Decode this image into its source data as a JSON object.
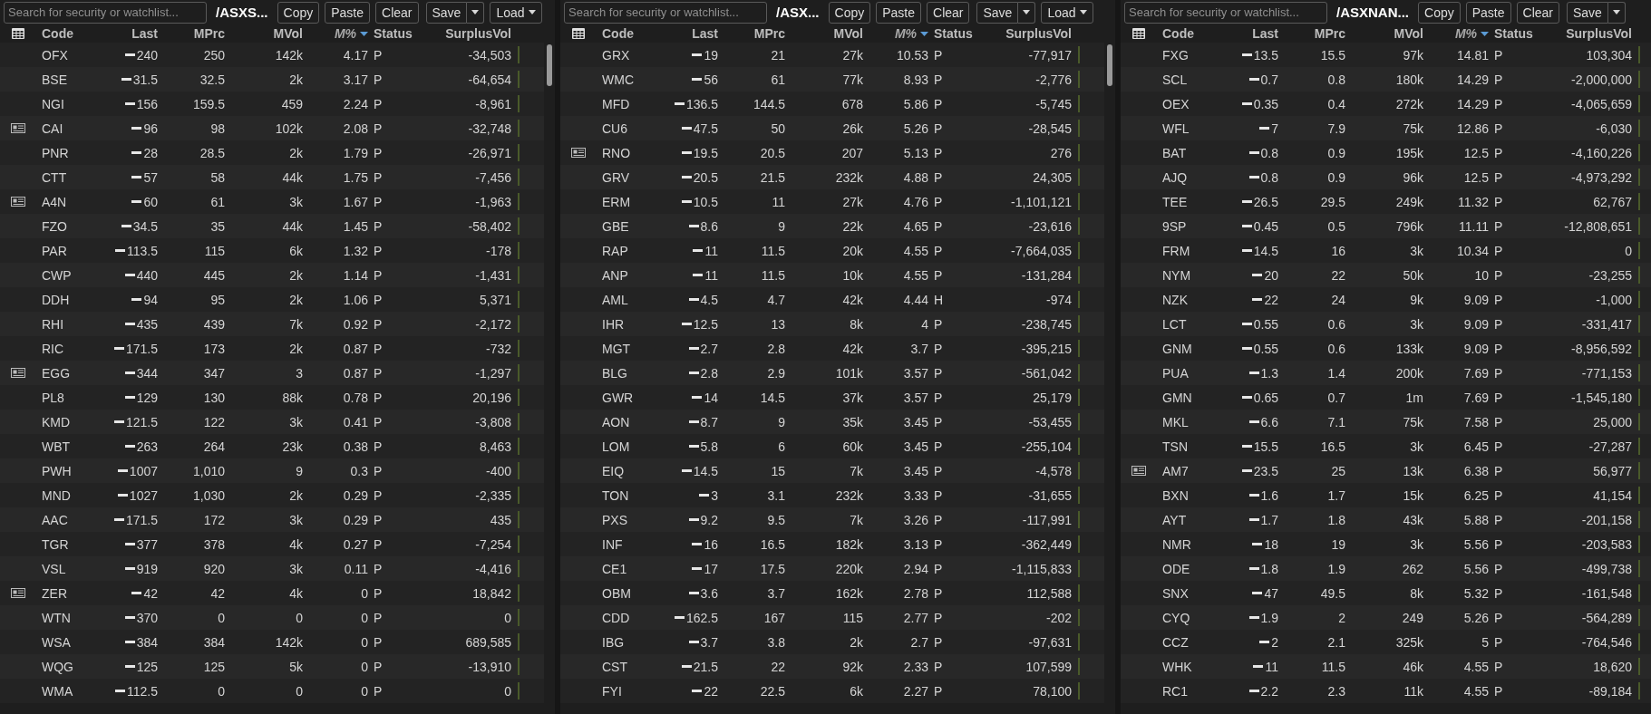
{
  "panels": [
    {
      "search": {
        "placeholder": "Search for security or watchlist..."
      },
      "title": "/ASXS...",
      "buttons": [
        {
          "label": "Copy",
          "kind": "plain"
        },
        {
          "label": "Paste",
          "kind": "plain"
        },
        {
          "label": "Clear",
          "kind": "plain"
        },
        {
          "label": "Save",
          "kind": "split"
        },
        {
          "label": "Load",
          "kind": "menu"
        }
      ],
      "columns": [
        {
          "label": "Code",
          "sorted": false
        },
        {
          "label": "Last",
          "sorted": false
        },
        {
          "label": "MPrc",
          "sorted": false
        },
        {
          "label": "MVol",
          "sorted": false
        },
        {
          "label": "M%",
          "sorted": true
        },
        {
          "label": "Status",
          "sorted": false
        },
        {
          "label": "SurplusVol",
          "sorted": false
        }
      ],
      "scrollbar": true,
      "rows": [
        {
          "news": false,
          "cells": [
            "OFX",
            "240",
            "250",
            "142k",
            "4.17",
            "P",
            "-34,503"
          ]
        },
        {
          "news": false,
          "cells": [
            "BSE",
            "31.5",
            "32.5",
            "2k",
            "3.17",
            "P",
            "-64,654"
          ]
        },
        {
          "news": false,
          "cells": [
            "NGI",
            "156",
            "159.5",
            "459",
            "2.24",
            "P",
            "-8,961"
          ]
        },
        {
          "news": true,
          "cells": [
            "CAI",
            "96",
            "98",
            "102k",
            "2.08",
            "P",
            "-32,748"
          ]
        },
        {
          "news": false,
          "cells": [
            "PNR",
            "28",
            "28.5",
            "2k",
            "1.79",
            "P",
            "-26,971"
          ]
        },
        {
          "news": false,
          "cells": [
            "CTT",
            "57",
            "58",
            "44k",
            "1.75",
            "P",
            "-7,456"
          ]
        },
        {
          "news": true,
          "cells": [
            "A4N",
            "60",
            "61",
            "3k",
            "1.67",
            "P",
            "-1,963"
          ]
        },
        {
          "news": false,
          "cells": [
            "FZO",
            "34.5",
            "35",
            "44k",
            "1.45",
            "P",
            "-58,402"
          ]
        },
        {
          "news": false,
          "cells": [
            "PAR",
            "113.5",
            "115",
            "6k",
            "1.32",
            "P",
            "-178"
          ]
        },
        {
          "news": false,
          "cells": [
            "CWP",
            "440",
            "445",
            "2k",
            "1.14",
            "P",
            "-1,431"
          ]
        },
        {
          "news": false,
          "cells": [
            "DDH",
            "94",
            "95",
            "2k",
            "1.06",
            "P",
            "5,371"
          ]
        },
        {
          "news": false,
          "cells": [
            "RHI",
            "435",
            "439",
            "7k",
            "0.92",
            "P",
            "-2,172"
          ]
        },
        {
          "news": false,
          "cells": [
            "RIC",
            "171.5",
            "173",
            "2k",
            "0.87",
            "P",
            "-732"
          ]
        },
        {
          "news": true,
          "cells": [
            "EGG",
            "344",
            "347",
            "3",
            "0.87",
            "P",
            "-1,297"
          ]
        },
        {
          "news": false,
          "cells": [
            "PL8",
            "129",
            "130",
            "88k",
            "0.78",
            "P",
            "20,196"
          ]
        },
        {
          "news": false,
          "cells": [
            "KMD",
            "121.5",
            "122",
            "3k",
            "0.41",
            "P",
            "-3,808"
          ]
        },
        {
          "news": false,
          "cells": [
            "WBT",
            "263",
            "264",
            "23k",
            "0.38",
            "P",
            "8,463"
          ]
        },
        {
          "news": false,
          "cells": [
            "PWH",
            "1007",
            "1,010",
            "9",
            "0.3",
            "P",
            "-400"
          ]
        },
        {
          "news": false,
          "cells": [
            "MND",
            "1027",
            "1,030",
            "2k",
            "0.29",
            "P",
            "-2,335"
          ]
        },
        {
          "news": false,
          "cells": [
            "AAC",
            "171.5",
            "172",
            "3k",
            "0.29",
            "P",
            "435"
          ]
        },
        {
          "news": false,
          "cells": [
            "TGR",
            "377",
            "378",
            "4k",
            "0.27",
            "P",
            "-7,254"
          ]
        },
        {
          "news": false,
          "cells": [
            "VSL",
            "919",
            "920",
            "3k",
            "0.11",
            "P",
            "-4,416"
          ]
        },
        {
          "news": true,
          "cells": [
            "ZER",
            "42",
            "42",
            "4k",
            "0",
            "P",
            "18,842"
          ]
        },
        {
          "news": false,
          "cells": [
            "WTN",
            "370",
            "0",
            "0",
            "0",
            "P",
            "0"
          ]
        },
        {
          "news": false,
          "cells": [
            "WSA",
            "384",
            "384",
            "142k",
            "0",
            "P",
            "689,585"
          ]
        },
        {
          "news": false,
          "cells": [
            "WQG",
            "125",
            "125",
            "5k",
            "0",
            "P",
            "-13,910"
          ]
        },
        {
          "news": false,
          "cells": [
            "WMA",
            "112.5",
            "0",
            "0",
            "0",
            "P",
            "0"
          ]
        }
      ]
    },
    {
      "search": {
        "placeholder": "Search for security or watchlist..."
      },
      "title": "/ASX...",
      "buttons": [
        {
          "label": "Copy",
          "kind": "plain"
        },
        {
          "label": "Paste",
          "kind": "plain"
        },
        {
          "label": "Clear",
          "kind": "plain"
        },
        {
          "label": "Save",
          "kind": "split"
        },
        {
          "label": "Load",
          "kind": "menu"
        }
      ],
      "columns": [
        {
          "label": "Code",
          "sorted": false
        },
        {
          "label": "Last",
          "sorted": false
        },
        {
          "label": "MPrc",
          "sorted": false
        },
        {
          "label": "MVol",
          "sorted": false
        },
        {
          "label": "M%",
          "sorted": true
        },
        {
          "label": "Status",
          "sorted": false
        },
        {
          "label": "SurplusVol",
          "sorted": false
        }
      ],
      "scrollbar": true,
      "rows": [
        {
          "news": false,
          "cells": [
            "GRX",
            "19",
            "21",
            "27k",
            "10.53",
            "P",
            "-77,917"
          ]
        },
        {
          "news": false,
          "cells": [
            "WMC",
            "56",
            "61",
            "77k",
            "8.93",
            "P",
            "-2,776"
          ]
        },
        {
          "news": false,
          "cells": [
            "MFD",
            "136.5",
            "144.5",
            "678",
            "5.86",
            "P",
            "-5,745"
          ]
        },
        {
          "news": false,
          "cells": [
            "CU6",
            "47.5",
            "50",
            "26k",
            "5.26",
            "P",
            "-28,545"
          ]
        },
        {
          "news": true,
          "cells": [
            "RNO",
            "19.5",
            "20.5",
            "207",
            "5.13",
            "P",
            "276"
          ]
        },
        {
          "news": false,
          "cells": [
            "GRV",
            "20.5",
            "21.5",
            "232k",
            "4.88",
            "P",
            "24,305"
          ]
        },
        {
          "news": false,
          "cells": [
            "ERM",
            "10.5",
            "11",
            "27k",
            "4.76",
            "P",
            "-1,101,121"
          ]
        },
        {
          "news": false,
          "cells": [
            "GBE",
            "8.6",
            "9",
            "22k",
            "4.65",
            "P",
            "-23,616"
          ]
        },
        {
          "news": false,
          "cells": [
            "RAP",
            "11",
            "11.5",
            "20k",
            "4.55",
            "P",
            "-7,664,035"
          ]
        },
        {
          "news": false,
          "cells": [
            "ANP",
            "11",
            "11.5",
            "10k",
            "4.55",
            "P",
            "-131,284"
          ]
        },
        {
          "news": false,
          "cells": [
            "AML",
            "4.5",
            "4.7",
            "42k",
            "4.44",
            "H",
            "-974"
          ]
        },
        {
          "news": false,
          "cells": [
            "IHR",
            "12.5",
            "13",
            "8k",
            "4",
            "P",
            "-238,745"
          ]
        },
        {
          "news": false,
          "cells": [
            "MGT",
            "2.7",
            "2.8",
            "42k",
            "3.7",
            "P",
            "-395,215"
          ]
        },
        {
          "news": false,
          "cells": [
            "BLG",
            "2.8",
            "2.9",
            "101k",
            "3.57",
            "P",
            "-561,042"
          ]
        },
        {
          "news": false,
          "cells": [
            "GWR",
            "14",
            "14.5",
            "37k",
            "3.57",
            "P",
            "25,179"
          ]
        },
        {
          "news": false,
          "cells": [
            "AON",
            "8.7",
            "9",
            "35k",
            "3.45",
            "P",
            "-53,455"
          ]
        },
        {
          "news": false,
          "cells": [
            "LOM",
            "5.8",
            "6",
            "60k",
            "3.45",
            "P",
            "-255,104"
          ]
        },
        {
          "news": false,
          "cells": [
            "EIQ",
            "14.5",
            "15",
            "7k",
            "3.45",
            "P",
            "-4,578"
          ]
        },
        {
          "news": false,
          "cells": [
            "TON",
            "3",
            "3.1",
            "232k",
            "3.33",
            "P",
            "-31,655"
          ]
        },
        {
          "news": false,
          "cells": [
            "PXS",
            "9.2",
            "9.5",
            "7k",
            "3.26",
            "P",
            "-117,991"
          ]
        },
        {
          "news": false,
          "cells": [
            "INF",
            "16",
            "16.5",
            "182k",
            "3.13",
            "P",
            "-362,449"
          ]
        },
        {
          "news": false,
          "cells": [
            "CE1",
            "17",
            "17.5",
            "220k",
            "2.94",
            "P",
            "-1,115,833"
          ]
        },
        {
          "news": false,
          "cells": [
            "OBM",
            "3.6",
            "3.7",
            "162k",
            "2.78",
            "P",
            "112,588"
          ]
        },
        {
          "news": false,
          "cells": [
            "CDD",
            "162.5",
            "167",
            "115",
            "2.77",
            "P",
            "-202"
          ]
        },
        {
          "news": false,
          "cells": [
            "IBG",
            "3.7",
            "3.8",
            "2k",
            "2.7",
            "P",
            "-97,631"
          ]
        },
        {
          "news": false,
          "cells": [
            "CST",
            "21.5",
            "22",
            "92k",
            "2.33",
            "P",
            "107,599"
          ]
        },
        {
          "news": false,
          "cells": [
            "FYI",
            "22",
            "22.5",
            "6k",
            "2.27",
            "P",
            "78,100"
          ]
        }
      ]
    },
    {
      "search": {
        "placeholder": "Search for security or watchlist..."
      },
      "title": "/ASXNAN...",
      "buttons": [
        {
          "label": "Copy",
          "kind": "plain"
        },
        {
          "label": "Paste",
          "kind": "plain"
        },
        {
          "label": "Clear",
          "kind": "plain"
        },
        {
          "label": "Save",
          "kind": "split"
        }
      ],
      "columns": [
        {
          "label": "Code",
          "sorted": false
        },
        {
          "label": "Last",
          "sorted": false
        },
        {
          "label": "MPrc",
          "sorted": false
        },
        {
          "label": "MVol",
          "sorted": false
        },
        {
          "label": "M%",
          "sorted": true
        },
        {
          "label": "Status",
          "sorted": false
        },
        {
          "label": "SurplusVol",
          "sorted": false
        }
      ],
      "scrollbar": false,
      "rows": [
        {
          "news": false,
          "cells": [
            "FXG",
            "13.5",
            "15.5",
            "97k",
            "14.81",
            "P",
            "103,304"
          ]
        },
        {
          "news": false,
          "cells": [
            "SCL",
            "0.7",
            "0.8",
            "180k",
            "14.29",
            "P",
            "-2,000,000"
          ]
        },
        {
          "news": false,
          "cells": [
            "OEX",
            "0.35",
            "0.4",
            "272k",
            "14.29",
            "P",
            "-4,065,659"
          ]
        },
        {
          "news": false,
          "cells": [
            "WFL",
            "7",
            "7.9",
            "75k",
            "12.86",
            "P",
            "-6,030"
          ]
        },
        {
          "news": false,
          "cells": [
            "BAT",
            "0.8",
            "0.9",
            "195k",
            "12.5",
            "P",
            "-4,160,226"
          ]
        },
        {
          "news": false,
          "cells": [
            "AJQ",
            "0.8",
            "0.9",
            "96k",
            "12.5",
            "P",
            "-4,973,292"
          ]
        },
        {
          "news": false,
          "cells": [
            "TEE",
            "26.5",
            "29.5",
            "249k",
            "11.32",
            "P",
            "62,767"
          ]
        },
        {
          "news": false,
          "cells": [
            "9SP",
            "0.45",
            "0.5",
            "796k",
            "11.11",
            "P",
            "-12,808,651"
          ]
        },
        {
          "news": false,
          "cells": [
            "FRM",
            "14.5",
            "16",
            "3k",
            "10.34",
            "P",
            "0"
          ]
        },
        {
          "news": false,
          "cells": [
            "NYM",
            "20",
            "22",
            "50k",
            "10",
            "P",
            "-23,255"
          ]
        },
        {
          "news": false,
          "cells": [
            "NZK",
            "22",
            "24",
            "9k",
            "9.09",
            "P",
            "-1,000"
          ]
        },
        {
          "news": false,
          "cells": [
            "LCT",
            "0.55",
            "0.6",
            "3k",
            "9.09",
            "P",
            "-331,417"
          ]
        },
        {
          "news": false,
          "cells": [
            "GNM",
            "0.55",
            "0.6",
            "133k",
            "9.09",
            "P",
            "-8,956,592"
          ]
        },
        {
          "news": false,
          "cells": [
            "PUA",
            "1.3",
            "1.4",
            "200k",
            "7.69",
            "P",
            "-771,153"
          ]
        },
        {
          "news": false,
          "cells": [
            "GMN",
            "0.65",
            "0.7",
            "1m",
            "7.69",
            "P",
            "-1,545,180"
          ]
        },
        {
          "news": false,
          "cells": [
            "MKL",
            "6.6",
            "7.1",
            "75k",
            "7.58",
            "P",
            "25,000"
          ]
        },
        {
          "news": false,
          "cells": [
            "TSN",
            "15.5",
            "16.5",
            "3k",
            "6.45",
            "P",
            "-27,287"
          ]
        },
        {
          "news": true,
          "cells": [
            "AM7",
            "23.5",
            "25",
            "13k",
            "6.38",
            "P",
            "56,977"
          ]
        },
        {
          "news": false,
          "cells": [
            "BXN",
            "1.6",
            "1.7",
            "15k",
            "6.25",
            "P",
            "41,154"
          ]
        },
        {
          "news": false,
          "cells": [
            "AYT",
            "1.7",
            "1.8",
            "43k",
            "5.88",
            "P",
            "-201,158"
          ]
        },
        {
          "news": false,
          "cells": [
            "NMR",
            "18",
            "19",
            "3k",
            "5.56",
            "P",
            "-203,583"
          ]
        },
        {
          "news": false,
          "cells": [
            "ODE",
            "1.8",
            "1.9",
            "262",
            "5.56",
            "P",
            "-499,738"
          ]
        },
        {
          "news": false,
          "cells": [
            "SNX",
            "47",
            "49.5",
            "8k",
            "5.32",
            "P",
            "-161,548"
          ]
        },
        {
          "news": false,
          "cells": [
            "CYQ",
            "1.9",
            "2",
            "249",
            "5.26",
            "P",
            "-564,289"
          ]
        },
        {
          "news": false,
          "cells": [
            "CCZ",
            "2",
            "2.1",
            "325k",
            "5",
            "P",
            "-764,546"
          ]
        },
        {
          "news": false,
          "cells": [
            "WHK",
            "11",
            "11.5",
            "46k",
            "4.55",
            "P",
            "18,620"
          ]
        },
        {
          "news": false,
          "cells": [
            "RC1",
            "2.2",
            "2.3",
            "11k",
            "4.55",
            "P",
            "-89,184"
          ]
        }
      ]
    }
  ]
}
